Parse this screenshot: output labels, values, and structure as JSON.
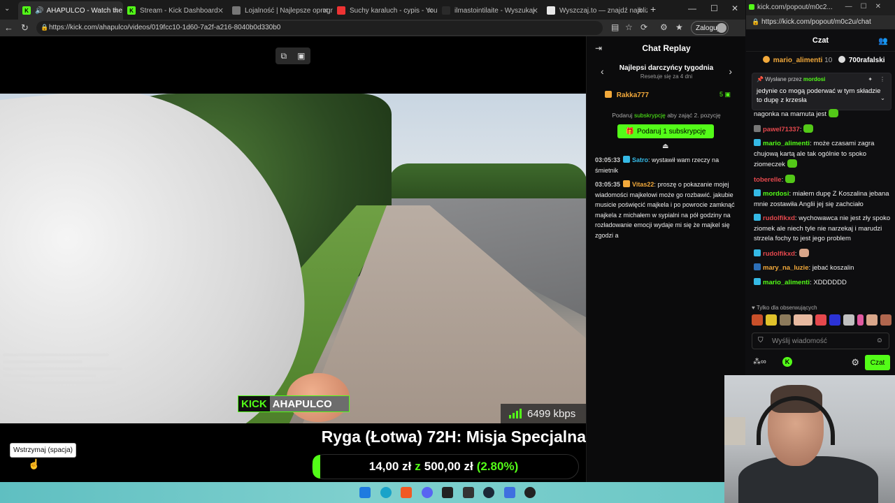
{
  "browser": {
    "tabs": [
      {
        "title": "AHAPULCO - Watch the VO",
        "active": true
      },
      {
        "title": "Stream - Kick Dashboard",
        "active": false
      },
      {
        "title": "Lojalność | Najlepsze oprogram",
        "active": false
      },
      {
        "title": "Suchy karaluch - cypis - YouTub",
        "active": false
      },
      {
        "title": "ilmastointilaite - Wyszukaj",
        "active": false
      },
      {
        "title": "Wyszczaj.to — znajdź najbliższą",
        "active": false
      }
    ],
    "url": "https://kick.com/ahapulco/videos/019fcc10-1d60-7a2f-a216-8040b0d330b0",
    "login_label": "Zaloguj"
  },
  "video": {
    "watermark_brand": "KICK",
    "watermark_name": "AHAPULCO",
    "kbps": "6499 kbps",
    "tooltip": "Wstrzymaj (spacja)"
  },
  "stream": {
    "title": "Ryga (Łotwa) 72H: Misja Specjalna",
    "goal_current": "14,00 zł",
    "goal_sep": "z",
    "goal_total": "500,00 zł",
    "goal_percent_label": "(2.80%)",
    "goal_fraction": 0.028
  },
  "replay": {
    "title": "Chat Replay",
    "leader_title": "Najlepsi darczyńcy tygodnia",
    "leader_sub": "Resetuje się za 4 dni",
    "top_donor": "Rakka777",
    "top_donor_count": "5",
    "gift_note_pre": "Podaruj",
    "gift_note_link": "subskrypcję",
    "gift_note_post": "aby zająć 2. pozycję",
    "gift_button": "Podaruj 1 subskrypcję",
    "messages": [
      {
        "time": "03:05:33",
        "user": "Satro",
        "color": "#35b9e5",
        "text": ": wystawił wam rzeczy na śmietnik"
      },
      {
        "time": "03:05:35",
        "user": "Vitas22",
        "color": "#f2a93b",
        "text": ": proszę o pokazanie mojej wiadomości majkelowi może go rozbawić. jakubie musicie poświęcić majkela i po powrocie zamknąć majkela z michałem w sypialni na pół godziny na rozładowanie emocji wydaje mi się że majkel się zgodzi a"
      }
    ]
  },
  "popout": {
    "window_title": "kick.com/popout/m0c2...",
    "url": "https://kick.com/popout/m0c2u/chat",
    "header": "Czat",
    "top_user1": "mario_alimenti",
    "top_user1_count": "10",
    "top_user2": "700rafalski",
    "pinned_by_label": "Wysłane przez",
    "pinned_by_user": "mordosi",
    "pinned_text": "jedynie co mogą poderwać w tym składzie to dupę z krzesła",
    "messages": [
      {
        "user": "",
        "color": "#eee",
        "text": "nagonka na mamuta jest"
      },
      {
        "user": "pawel71337",
        "color": "#e5484d",
        "text": ":"
      },
      {
        "user": "mario_alimenti",
        "color": "#53fc18",
        "text": ": może czasami zagra chujową kartą ale tak ogólnie to spoko ziomeczek"
      },
      {
        "user": "toberelle",
        "color": "#e5484d",
        "text": ":"
      },
      {
        "user": "mordosi",
        "color": "#53fc18",
        "text": ": miałem dupę Z Koszalina jebana mnie zostawiła Anglii jej się zachciało"
      },
      {
        "user": "rudolfikxd",
        "color": "#e5484d",
        "text": ": wychowawca nie jest zły spoko ziomek ale niech tyle nie narzekaj i marudzi strzela fochy to jest jego problem"
      },
      {
        "user": "rudolfikxd",
        "color": "#e5484d",
        "text": ":"
      },
      {
        "user": "mary_na_luzie",
        "color": "#f2a93b",
        "text": ": jebać koszalin"
      },
      {
        "user": "mario_alimenti",
        "color": "#53fc18",
        "text": ": XDDDDDD"
      }
    ],
    "followers_only": "Tylko dla obserwujących",
    "input_placeholder": "Wyślij wiadomość",
    "send_label": "Czat"
  },
  "colors": {
    "kick_green": "#53fc18",
    "background": "#0e0e10"
  }
}
